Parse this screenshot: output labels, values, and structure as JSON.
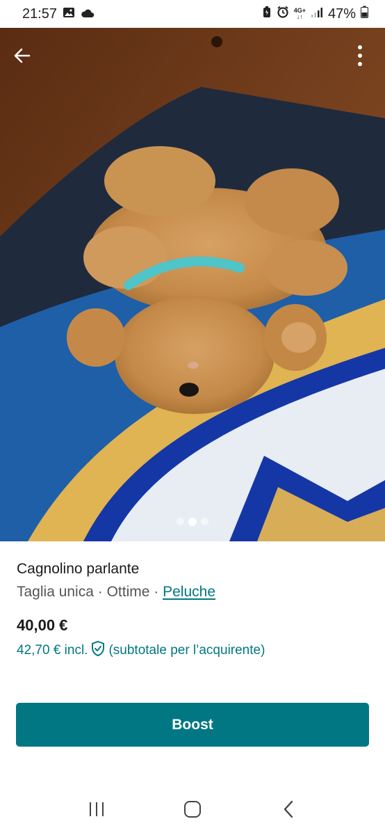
{
  "status_bar": {
    "time": "21:57",
    "network": "4G+",
    "battery": "47%"
  },
  "listing": {
    "title": "Cagnolino parlante",
    "size": "Taglia unica",
    "separator": "·",
    "condition": "Ottime",
    "category": "Peluche",
    "price": "40,00 €",
    "price_incl": "42,70 € incl.",
    "price_note": "(subtotale per l’acquirente)"
  },
  "gallery": {
    "photo_count": 3,
    "active_index": 1
  },
  "actions": {
    "boost_label": "Boost"
  },
  "colors": {
    "accent": "#007782",
    "text": "#1a1a1a",
    "muted": "#555555"
  },
  "icons": {
    "back": "arrow-left-icon",
    "more": "more-vertical-icon",
    "shield": "shield-check-icon",
    "nav_recents": "recents-icon",
    "nav_home": "home-icon",
    "nav_back": "chevron-left-icon"
  }
}
